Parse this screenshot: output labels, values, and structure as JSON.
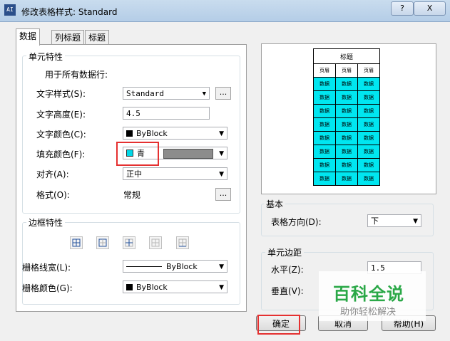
{
  "window": {
    "title": "修改表格样式: Standard",
    "app_icon": "AI",
    "help_label": "?",
    "close_label": "X"
  },
  "tabs": [
    {
      "label": "数据",
      "active": true
    },
    {
      "label": "列标题",
      "active": false
    },
    {
      "label": "标题",
      "active": false
    }
  ],
  "cell_props": {
    "legend": "单元特性",
    "apply_label": "用于所有数据行:",
    "text_style": {
      "label": "文字样式(S):",
      "value": "Standard",
      "button": "..."
    },
    "text_height": {
      "label": "文字高度(E):",
      "value": "4.5"
    },
    "text_color": {
      "label": "文字颜色(C):",
      "value": "ByBlock",
      "swatch": "#000000"
    },
    "fill_color": {
      "label": "填充颜色(F):",
      "value": "青",
      "swatch": "#00d8e8"
    },
    "align": {
      "label": "对齐(A):",
      "value": "正中"
    },
    "format": {
      "label": "格式(O):",
      "value": "常规",
      "button": "..."
    }
  },
  "border_props": {
    "legend": "边框特性",
    "grid_lineweight": {
      "label": "栅格线宽(L):",
      "value": "ByBlock"
    },
    "grid_color": {
      "label": "栅格颜色(G):",
      "value": "ByBlock",
      "swatch": "#000000"
    }
  },
  "preview": {
    "title": "标题",
    "header": [
      "页眉",
      "页眉",
      "页眉"
    ],
    "cell_text": "数据",
    "data_rows": 8,
    "data_fill": "#00e6f0"
  },
  "basic": {
    "legend": "基本",
    "direction": {
      "label": "表格方向(D):",
      "value": "下"
    }
  },
  "margins": {
    "legend": "单元边距",
    "horizontal": {
      "label": "水平(Z):",
      "value": "1.5"
    },
    "vertical": {
      "label": "垂直(V):"
    }
  },
  "buttons": {
    "ok": "确定",
    "cancel": "取消",
    "help": "帮助(H)"
  },
  "watermark": {
    "main": "百科全说",
    "sub": "助你轻松解决"
  },
  "highlight_color": "#e53030"
}
